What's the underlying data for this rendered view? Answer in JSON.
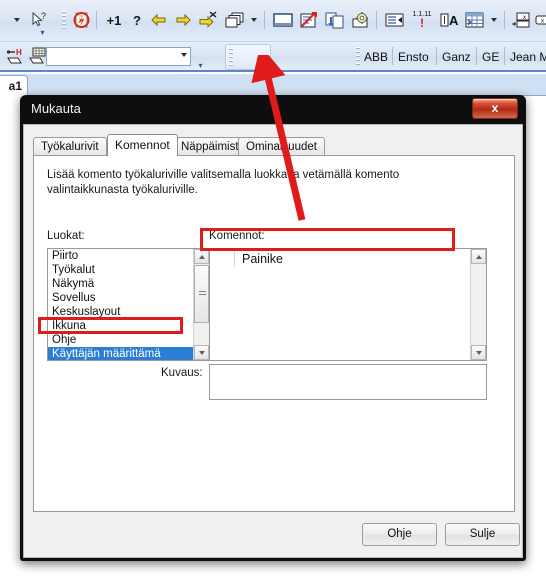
{
  "app": {
    "toolbar_row1": {
      "items": [
        {
          "name": "dropdown-caret",
          "icon": "caret-down-icon"
        },
        {
          "name": "select-help-pointer",
          "icon": "pointer-question-icon",
          "glyph": "↖?"
        },
        {
          "name": "overflow-handle-1",
          "icon": "toolbar-overflow-icon"
        },
        {
          "name": "grip-1",
          "icon": "toolbar-grip-icon"
        },
        {
          "name": "no-entry-doc",
          "icon": "forbidden-document-icon"
        },
        {
          "name": "separator-1",
          "icon": "separator-icon"
        },
        {
          "name": "plus-one",
          "icon": "plus-one-icon",
          "glyph": "+1"
        },
        {
          "name": "help-question",
          "icon": "question-mark-icon",
          "glyph": "?"
        },
        {
          "name": "back-arrow",
          "icon": "arrow-left-icon"
        },
        {
          "name": "forward-arrow",
          "icon": "arrow-right-icon"
        },
        {
          "name": "arrow-delete",
          "icon": "arrow-right-delete-icon"
        },
        {
          "name": "copy-layers",
          "icon": "stacked-windows-icon"
        },
        {
          "name": "layers-dropdown",
          "icon": "caret-down-icon"
        },
        {
          "name": "separator-2",
          "icon": "separator-icon"
        },
        {
          "name": "window-frame",
          "icon": "window-rectangle-icon"
        },
        {
          "name": "edit-redline",
          "icon": "edit-redline-icon"
        },
        {
          "name": "duplicate-blue",
          "icon": "duplicate-blue-icon"
        },
        {
          "name": "settings-gear",
          "icon": "gear-icon"
        },
        {
          "name": "separator-3",
          "icon": "separator-icon"
        },
        {
          "name": "list-view",
          "icon": "list-view-icon"
        },
        {
          "name": "renumber-alert",
          "icon": "renumber-alert-icon",
          "glyph": "1.1.11"
        },
        {
          "name": "text-label",
          "icon": "text-a-icon",
          "glyph": "A"
        },
        {
          "name": "table-grid",
          "icon": "table-grid-icon"
        },
        {
          "name": "table-dropdown",
          "icon": "caret-down-icon"
        },
        {
          "name": "separator-4",
          "icon": "separator-icon"
        },
        {
          "name": "insert-tag",
          "icon": "insert-tag-icon"
        },
        {
          "name": "tag-small",
          "icon": "small-tag-icon"
        },
        {
          "name": "delete-cross",
          "icon": "red-cross-delete-icon"
        },
        {
          "name": "separator-5",
          "icon": "separator-icon"
        },
        {
          "name": "export-green",
          "icon": "export-green-icon"
        }
      ]
    },
    "toolbar_row2": {
      "icons": [
        {
          "name": "insert-symbol-h",
          "icon": "symbol-h-icon"
        },
        {
          "name": "grid-sheet",
          "icon": "grid-sheet-icon"
        }
      ],
      "combo_value": "",
      "combo_placeholder": "",
      "vendor_buttons": [
        "ABB",
        "Ensto",
        "Ganz",
        "GE",
        "Jean Mü"
      ]
    },
    "document_tab": {
      "label": "a1"
    }
  },
  "dialog": {
    "title": "Mukauta",
    "close_label": "x",
    "tabs": [
      {
        "label": "Työkalurivit",
        "active": false
      },
      {
        "label": "Komennot",
        "active": true
      },
      {
        "label": "Näppäimistö",
        "active": false
      },
      {
        "label": "Ominaisuudet",
        "active": false
      }
    ],
    "instruction": "Lisää komento työkaluriville valitsemalla luokka ja vetämällä komento valintaikkunasta työkaluriville.",
    "categories_label": "Luokat:",
    "categories": [
      {
        "label": "Piirto",
        "selected": false
      },
      {
        "label": "Työkalut",
        "selected": false
      },
      {
        "label": "Näkymä",
        "selected": false
      },
      {
        "label": "Sovellus",
        "selected": false
      },
      {
        "label": "Keskuslayout",
        "selected": false
      },
      {
        "label": "Ikkuna",
        "selected": false
      },
      {
        "label": "Ohje",
        "selected": false
      },
      {
        "label": "Käyttäjän määrittämä",
        "selected": true
      }
    ],
    "commands_label": "Komennot:",
    "commands": [
      {
        "label": "Painike"
      }
    ],
    "description_label": "Kuvaus:",
    "description_value": "",
    "buttons": {
      "help": "Ohje",
      "close": "Sulje"
    }
  },
  "annotations": {
    "accent_color": "#e01b1b",
    "highlight_category": "Käyttäjän määrittämä",
    "highlight_command": "Painike",
    "arrow_description": "drag Painike to empty toolbar"
  },
  "colors": {
    "selection_blue": "#2a7fd4",
    "toolbar_blue": "#dbe6f4",
    "dialog_chrome": "#0e0e0e",
    "close_red": "#b32a13"
  }
}
